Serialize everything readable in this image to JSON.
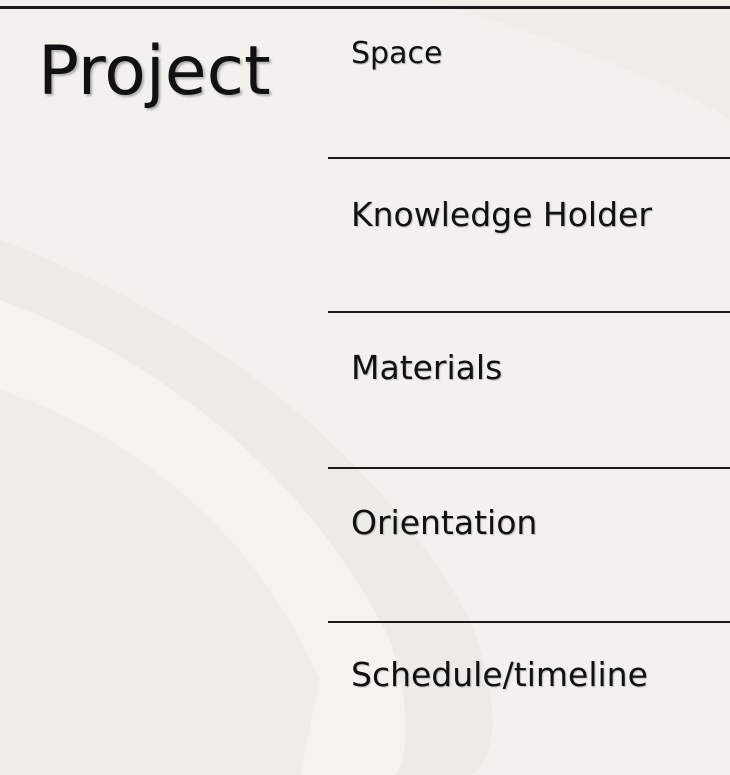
{
  "slide": {
    "title": "Project",
    "items": [
      {
        "label": "Space"
      },
      {
        "label": "Knowledge Holder"
      },
      {
        "label": "Materials"
      },
      {
        "label": "Orientation"
      },
      {
        "label": "Schedule/timeline"
      }
    ]
  },
  "colors": {
    "background": "#f3f1ed",
    "swoosh": "#e9e6e0",
    "rule": "#1a1a1a",
    "text": "#111111"
  }
}
